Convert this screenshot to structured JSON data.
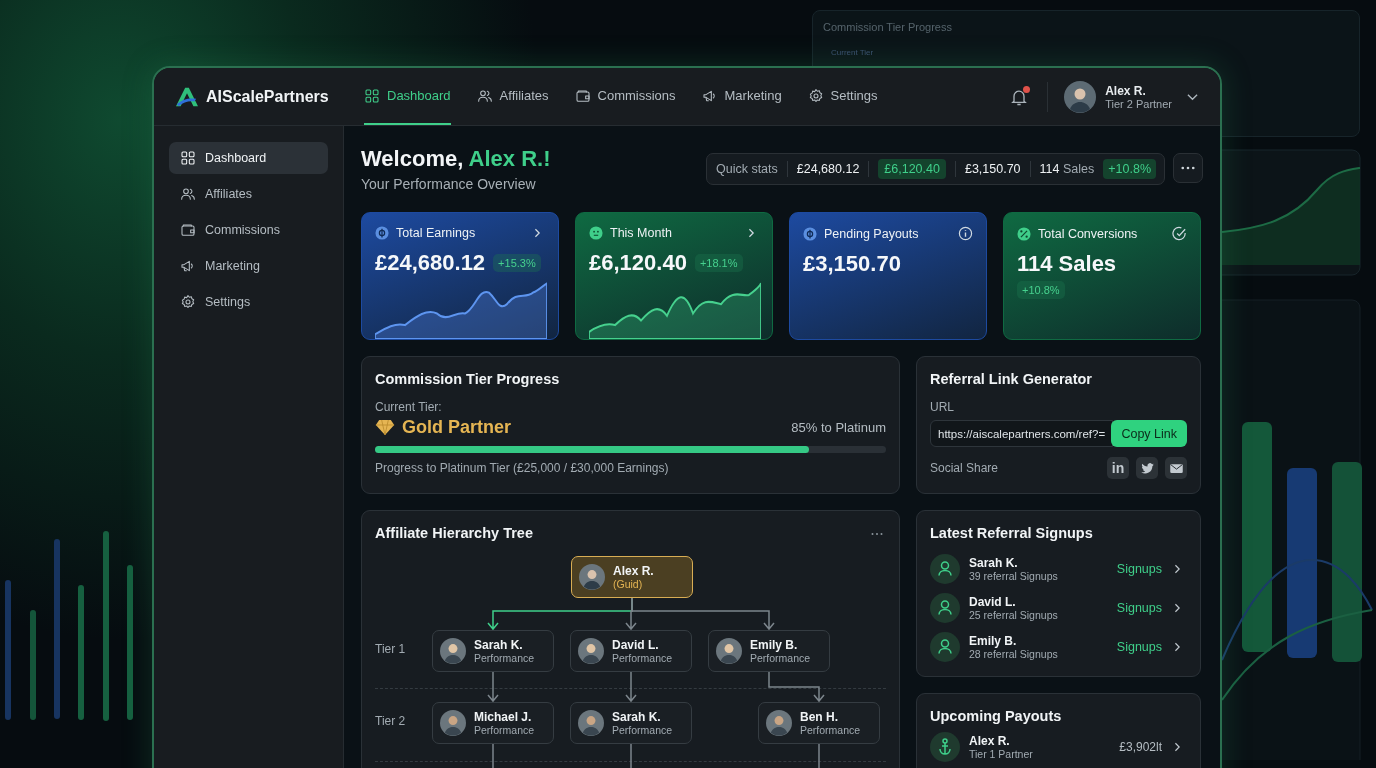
{
  "backdrop": {
    "title": "Commission Tier Progress",
    "label": "Current Tier"
  },
  "brand": {
    "name": "AIScalePartners"
  },
  "nav": [
    {
      "label": "Dashboard",
      "kind": "dashboard",
      "selected": true
    },
    {
      "label": "Affiliates",
      "kind": "affiliates",
      "selected": false
    },
    {
      "label": "Commissions",
      "kind": "commissions",
      "selected": false
    },
    {
      "label": "Marketing",
      "kind": "marketing",
      "selected": false
    },
    {
      "label": "Settings",
      "kind": "settings",
      "selected": false
    }
  ],
  "notifications": {
    "unread": true
  },
  "user": {
    "name": "Alex R.",
    "role": "Tier 2 Partner"
  },
  "sidebar": {
    "items": [
      {
        "label": "Dashboard",
        "kind": "dashboard",
        "selected": true
      },
      {
        "label": "Affiliates",
        "kind": "affiliates",
        "selected": false
      },
      {
        "label": "Commissions",
        "kind": "commissions",
        "selected": false
      },
      {
        "label": "Marketing",
        "kind": "marketing",
        "selected": false
      },
      {
        "label": "Settings",
        "kind": "settings",
        "selected": false
      }
    ]
  },
  "welcome": {
    "greeting": "Welcome,",
    "name": "Alex R.!",
    "subtitle": "Your Performance Overview"
  },
  "quick_stats": {
    "label": "Quick stats",
    "items": [
      {
        "value": "£24,680.12",
        "selected": false
      },
      {
        "value": "£6,120.40",
        "selected": true
      },
      {
        "value": "£3,150.70",
        "selected": false
      }
    ],
    "count": "114",
    "count_unit": "Sales",
    "change": "+10.8%"
  },
  "stat_cards": [
    {
      "title": "Total Earnings",
      "value": "£24,680.12",
      "change": "+15.3%",
      "kind": "trend",
      "color": "#1d4aa0"
    },
    {
      "title": "This Month",
      "value": "£6,120.40",
      "change": "+18.1%",
      "kind": "trend",
      "color": "#0f6a42"
    },
    {
      "title": "Pending Payouts",
      "value": "£3,150.70",
      "kind": "pending",
      "color": "#1d4aa0"
    },
    {
      "title": "Total Conversions",
      "value": "114 Sales",
      "change": "+10.8%",
      "kind": "count",
      "color": "#0f6a42"
    }
  ],
  "tier_progress": {
    "title": "Commission Tier Progress",
    "label": "Current Tier:",
    "tier": "Gold Partner",
    "target": "85% to Platinum",
    "level": 0.85,
    "caption": "Progress to Platinum Tier (£25,000 / £30,000 Earnings)"
  },
  "referral": {
    "title": "Referral Link Generator",
    "url_label": "URL",
    "url": "https://aiscalepartners.com/ref?=",
    "button": "Copy Link",
    "share_label": "Social Share",
    "share": [
      {
        "kind": "text",
        "glyph": "in"
      },
      {
        "kind": "bird"
      },
      {
        "kind": "mail"
      }
    ]
  },
  "tree": {
    "title": "Affiliate Hierarchy Tree",
    "tiers": [
      "Tier 1",
      "Tier 2"
    ],
    "root": {
      "name": "Alex R.",
      "subtitle": "(Guid)",
      "selected": true,
      "children": [
        {
          "name": "Sarah K.",
          "subtitle": "Performance",
          "selected": false,
          "highlighted": true,
          "children": [
            {
              "name": "Michael J.",
              "subtitle": "Performance",
              "selected": false,
              "highlighted": false
            }
          ]
        },
        {
          "name": "David L.",
          "subtitle": "Performance",
          "selected": false,
          "highlighted": false,
          "children": [
            {
              "name": "Sarah K.",
              "subtitle": "Performance",
              "selected": false,
              "highlighted": false
            }
          ]
        },
        {
          "name": "Emily B.",
          "subtitle": "Performance",
          "selected": false,
          "highlighted": false,
          "children": [
            {
              "name": "Ben H.",
              "subtitle": "Performance",
              "selected": false,
              "highlighted": false
            }
          ]
        }
      ]
    }
  },
  "signups": {
    "title": "Latest Referral Signups",
    "items": [
      {
        "name": "Sarah K.",
        "detail": "39 referral Signups",
        "action": "Signups"
      },
      {
        "name": "David L.",
        "detail": "25 referral Signups",
        "action": "Signups"
      },
      {
        "name": "Emily B.",
        "detail": "28 referral Signups",
        "action": "Signups"
      }
    ]
  },
  "payouts": {
    "title": "Upcoming Payouts",
    "items": [
      {
        "name": "Alex R.",
        "detail": "Tier 1 Partner",
        "amount": "£3,902lt"
      }
    ]
  }
}
